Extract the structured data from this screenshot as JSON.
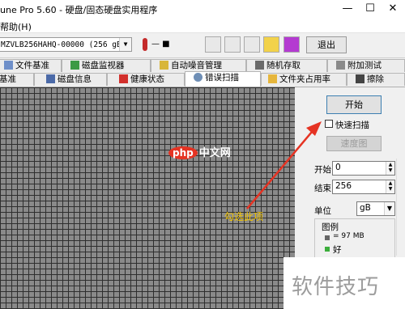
{
  "window": {
    "title": "une Pro 5.60 - 硬盘/固态硬盘实用程序",
    "min": "—",
    "max": "☐",
    "close": "✕"
  },
  "menu": {
    "help": "帮助(H)"
  },
  "toolbar": {
    "drive": "MZVLB256HAHQ-00000 (256 gB)",
    "temp": "— ■",
    "exit": "退出"
  },
  "tabs_row1": [
    {
      "label": "文件基准",
      "icon": "file-icon"
    },
    {
      "label": "磁盘监视器",
      "icon": "monitor-icon"
    },
    {
      "label": "自动噪音管理",
      "icon": "speaker-icon"
    },
    {
      "label": "随机存取",
      "icon": "random-icon"
    },
    {
      "label": "附加测试",
      "icon": "extra-icon"
    }
  ],
  "tabs_row2": [
    {
      "label": "基准",
      "icon": ""
    },
    {
      "label": "磁盘信息",
      "icon": "info-icon"
    },
    {
      "label": "健康状态",
      "icon": "health-icon"
    },
    {
      "label": "错误扫描",
      "icon": "magnifier-icon",
      "active": true
    },
    {
      "label": "文件夹占用率",
      "icon": "folder-icon"
    },
    {
      "label": "擦除",
      "icon": "erase-icon"
    }
  ],
  "scan": {
    "start": "开始",
    "quick_scan": "快速扫描",
    "quick_scan_checked": false,
    "detail": "速度图",
    "start_label": "开始",
    "start_value": "0",
    "end_label": "结束",
    "end_value": "256",
    "unit_label": "单位",
    "unit_value": "gB",
    "legend_label": "图例",
    "legend_block": "= 97 MB",
    "legend_ok": "好"
  },
  "annotation": {
    "text": "勾选此项"
  },
  "watermark": {
    "php": "php",
    "cn": "中文网",
    "site": "软件技巧"
  },
  "colors": {
    "red": "#e53323",
    "accent": "#f2c400"
  }
}
